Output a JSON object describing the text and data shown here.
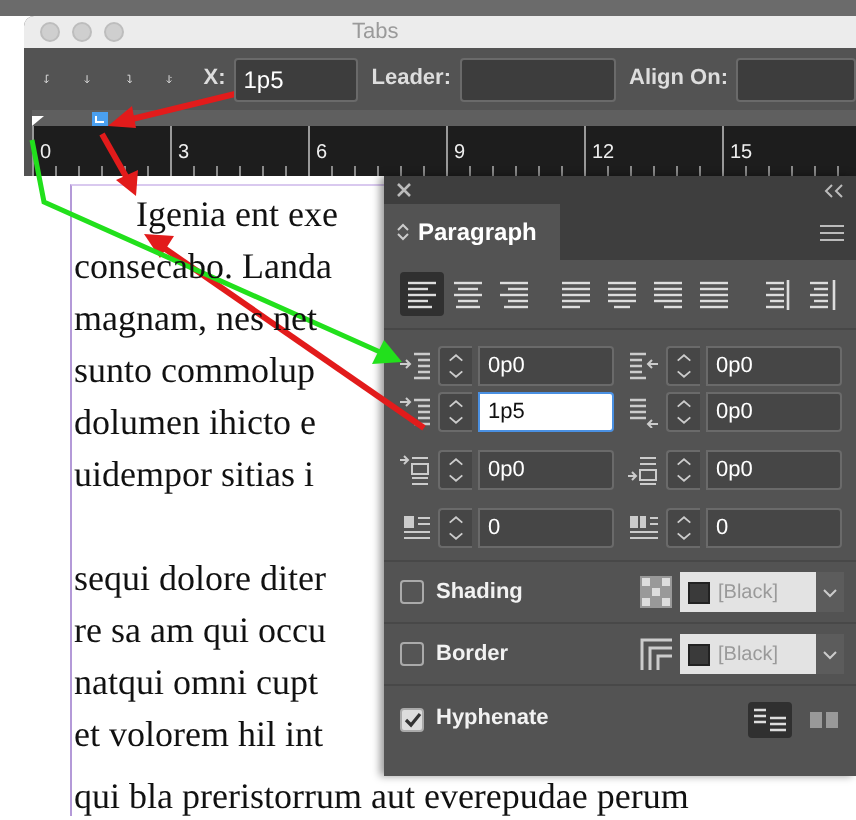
{
  "tabs_window": {
    "title": "Tabs",
    "x_field": {
      "label": "X:",
      "value": "1p5"
    },
    "leader_field": {
      "label": "Leader:"
    },
    "align_on_field": {
      "label": "Align On:"
    },
    "ruler_labels": [
      "0",
      "3",
      "6",
      "9",
      "12",
      "15"
    ]
  },
  "document": {
    "paragraphs": [
      {
        "first_line_indent": true,
        "lines": [
          "Igenia ent exe",
          "consecabo. Landa",
          "magnam, nes net",
          "sunto commolup",
          "dolumen ihicto e",
          "uidempor sitias i"
        ]
      },
      {
        "first_line_indent": false,
        "lines": [
          "sequi dolore diter",
          "re sa am qui occu",
          "natqui omni cupt",
          "et volorem hil int"
        ]
      }
    ],
    "last_line": "qui bla preristorrum aut everepudae perum"
  },
  "paragraph_panel": {
    "title": "Paragraph",
    "alignment_buttons": [
      {
        "selected": true
      },
      {
        "selected": false
      },
      {
        "selected": false
      },
      {
        "selected": false
      },
      {
        "selected": false
      },
      {
        "selected": false
      },
      {
        "selected": false
      },
      {
        "selected": false
      },
      {
        "selected": false
      }
    ],
    "fields": [
      {
        "value": "0p0",
        "focused": false
      },
      {
        "value": "0p0",
        "focused": false
      },
      {
        "value": "1p5",
        "focused": true
      },
      {
        "value": "0p0",
        "focused": false
      },
      {
        "value": "0p0",
        "focused": false
      },
      {
        "value": "0p0",
        "focused": false
      },
      {
        "value": "0",
        "focused": false
      },
      {
        "value": "0",
        "focused": false
      }
    ],
    "options": [
      {
        "kind": "swatch",
        "label": "Shading",
        "checked": false,
        "swatch": "[Black]"
      },
      {
        "kind": "swatch",
        "label": "Border",
        "checked": false,
        "swatch": "[Black]"
      },
      {
        "kind": "compose",
        "label": "Hyphenate",
        "checked": true
      }
    ],
    "compose_buttons": [
      {
        "selected": true
      },
      {
        "selected": false
      }
    ]
  }
}
